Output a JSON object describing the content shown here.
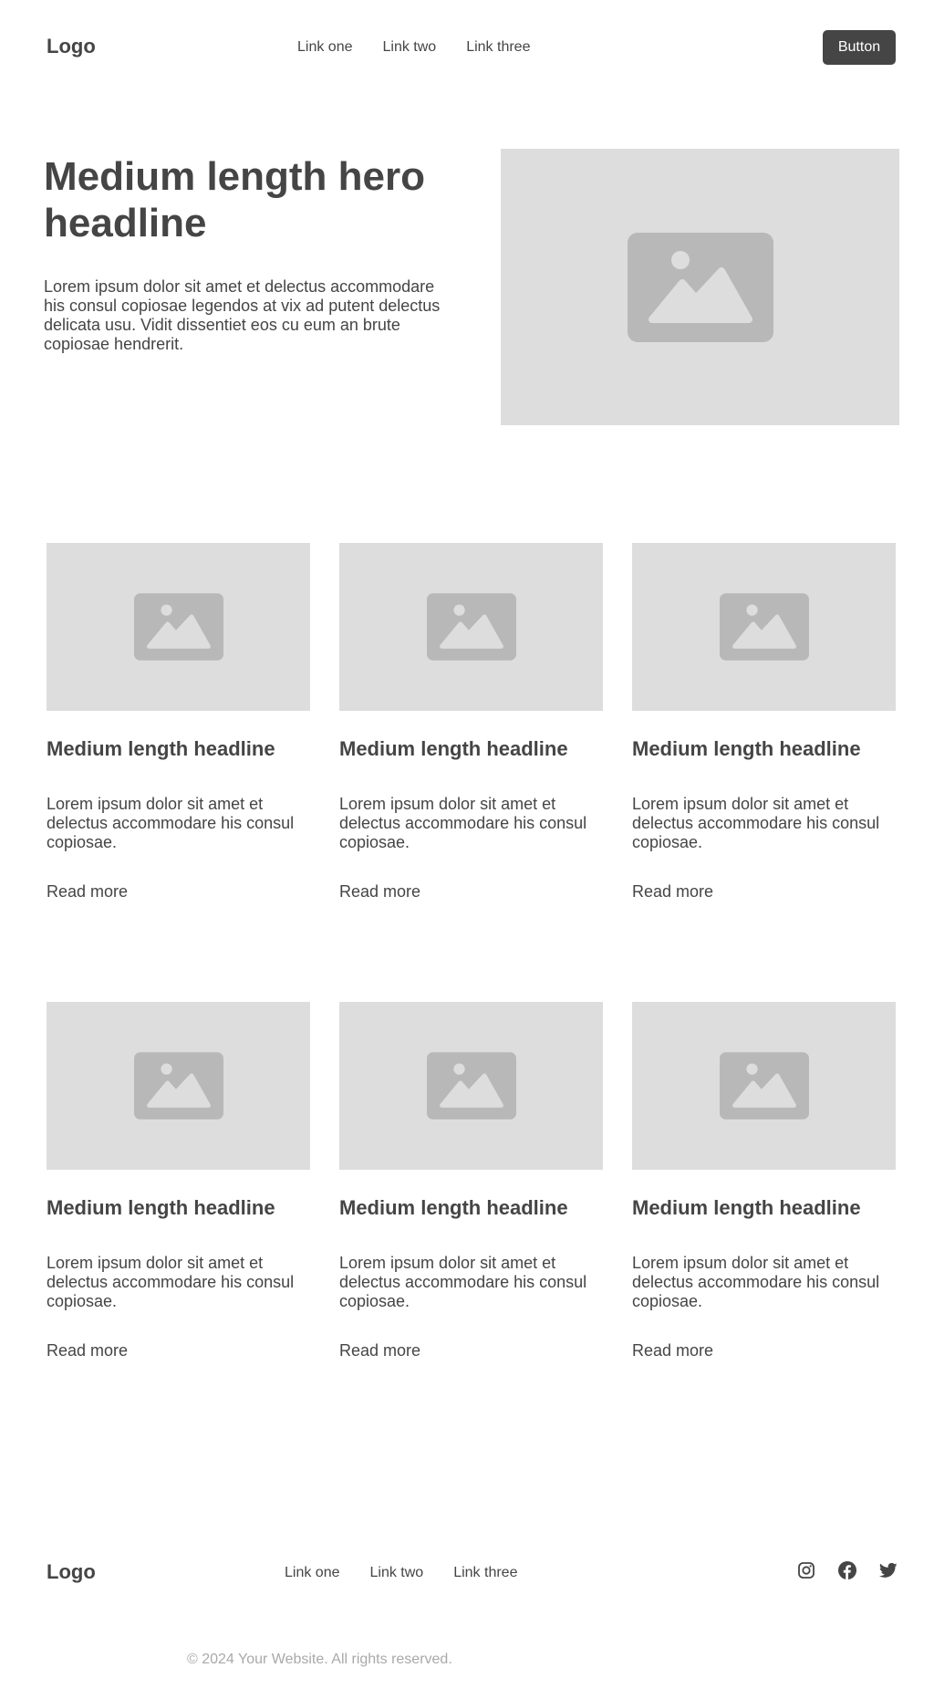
{
  "header": {
    "logo": "Logo",
    "nav": [
      "Link one",
      "Link two",
      "Link three"
    ],
    "button_label": "Button"
  },
  "hero": {
    "headline": "Medium length hero headline",
    "body": "Lorem ipsum dolor sit amet et delectus accommodare his consul copiosae legendos at vix ad putent delectus delicata usu. Vidit dissentiet eos cu eum an brute copiosae hendrerit.",
    "image_icon": "image-placeholder-icon"
  },
  "cards": [
    {
      "headline": "Medium length headline",
      "body": "Lorem ipsum dolor sit amet et delectus accommodare his consul copiosae.",
      "link": "Read more",
      "image_icon": "image-placeholder-icon"
    },
    {
      "headline": "Medium length headline",
      "body": "Lorem ipsum dolor sit amet et delectus accommodare his consul copiosae.",
      "link": "Read more",
      "image_icon": "image-placeholder-icon"
    },
    {
      "headline": "Medium length headline",
      "body": "Lorem ipsum dolor sit amet et delectus accommodare his consul copiosae.",
      "link": "Read more",
      "image_icon": "image-placeholder-icon"
    },
    {
      "headline": "Medium length headline",
      "body": "Lorem ipsum dolor sit amet et delectus accommodare his consul copiosae.",
      "link": "Read more",
      "image_icon": "image-placeholder-icon"
    },
    {
      "headline": "Medium length headline",
      "body": "Lorem ipsum dolor sit amet et delectus accommodare his consul copiosae.",
      "link": "Read more",
      "image_icon": "image-placeholder-icon"
    },
    {
      "headline": "Medium length headline",
      "body": "Lorem ipsum dolor sit amet et delectus accommodare his consul copiosae.",
      "link": "Read more",
      "image_icon": "image-placeholder-icon"
    }
  ],
  "footer": {
    "logo": "Logo",
    "nav": [
      "Link one",
      "Link two",
      "Link three"
    ],
    "social_icons": [
      "instagram-icon",
      "facebook-icon",
      "twitter-icon"
    ],
    "copyright": "© 2024 Your Website. All rights reserved."
  },
  "colors": {
    "text": "#454545",
    "placeholder_bg": "#dddddd",
    "placeholder_icon": "#b8b8b8",
    "button_bg": "#454545",
    "button_text": "#ffffff",
    "muted_text": "#a9a9a9"
  }
}
